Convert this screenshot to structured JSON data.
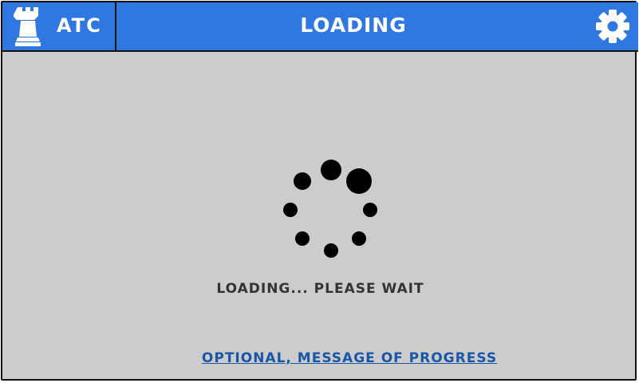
{
  "header": {
    "app_name": "ATC",
    "app_icon": "chess-rook-icon",
    "title": "LOADING",
    "settings_icon": "gear-icon"
  },
  "main": {
    "status_text": "LOADING... PLEASE WAIT",
    "progress_message": "OPTIONAL, MESSAGE OF PROGRESS",
    "spinner_icon": "loading-spinner-icon"
  },
  "colors": {
    "header_background": "#2f78e2",
    "content_background": "#cccccc",
    "link_color": "#1a56a8",
    "spinner_dots": "#000000"
  }
}
